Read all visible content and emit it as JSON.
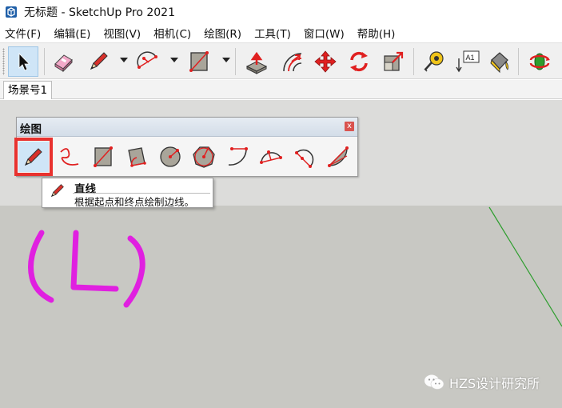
{
  "window": {
    "title": "无标题 - SketchUp Pro 2021"
  },
  "menu": [
    {
      "label": "文件(F)"
    },
    {
      "label": "编辑(E)"
    },
    {
      "label": "视图(V)"
    },
    {
      "label": "相机(C)"
    },
    {
      "label": "绘图(R)"
    },
    {
      "label": "工具(T)"
    },
    {
      "label": "窗口(W)"
    },
    {
      "label": "帮助(H)"
    }
  ],
  "toolbar": {
    "tools": [
      "select-icon",
      "eraser-icon",
      "pencil-icon",
      "arc-icon",
      "rectangle-icon",
      "push-pull-icon",
      "offset-icon",
      "move-icon",
      "rotate-icon",
      "scale-icon",
      "tape-measure-icon",
      "text-icon",
      "paint-bucket-icon",
      "orbit-icon"
    ],
    "text_tool_label": "A1"
  },
  "scene_tabs": [
    {
      "label": "场景号1"
    }
  ],
  "draw_palette": {
    "title": "绘图",
    "close_glyph": "x",
    "tools": [
      "line-tool-icon",
      "freehand-tool-icon",
      "rectangle-tool-icon",
      "rotated-rectangle-tool-icon",
      "circle-tool-icon",
      "polygon-tool-icon",
      "arc-tool-icon",
      "two-point-arc-tool-icon",
      "three-point-arc-tool-icon",
      "pie-tool-icon"
    ]
  },
  "tooltip": {
    "title": "直线",
    "description": "根据起点和终点绘制边线。"
  },
  "annotation": {
    "text": "(L)",
    "color": "#e020e0"
  },
  "watermark": {
    "text": "HZS设计研究所"
  },
  "colors": {
    "accent_red": "#e8322f",
    "axis_green": "#2e9e2e",
    "tool_red": "#e02020",
    "face_gray": "#a9a59a"
  }
}
